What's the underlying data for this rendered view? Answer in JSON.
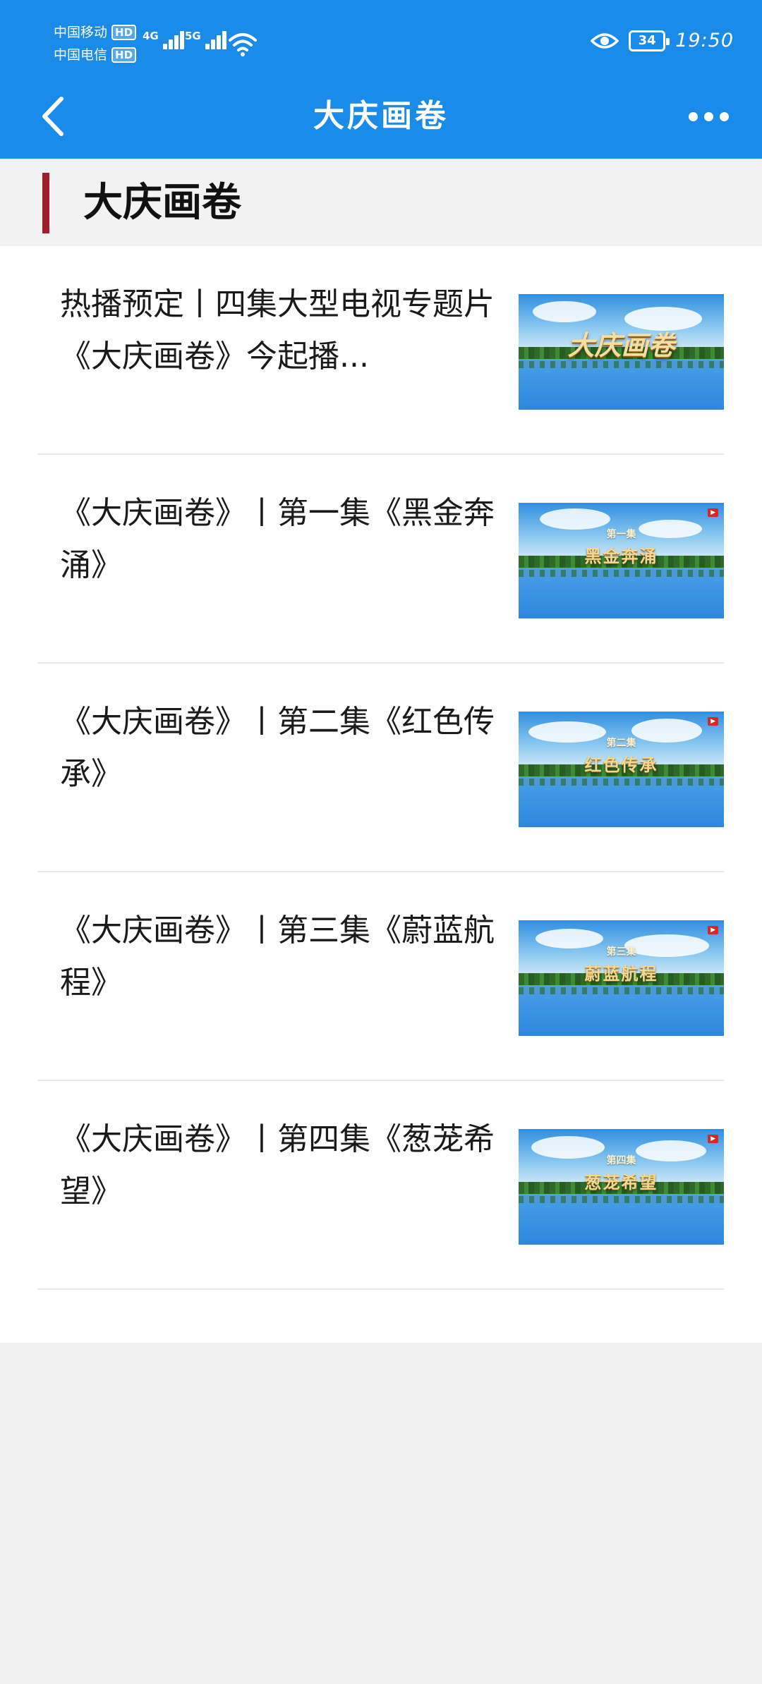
{
  "status_bar": {
    "carrier_1": "中国移动",
    "carrier_2": "中国电信",
    "hd_badge": "HD",
    "net_1": "4G",
    "net_2": "5G",
    "battery_level": "34",
    "time": "19:50"
  },
  "app_bar": {
    "title": "大庆画卷",
    "back_icon": "chevron-left-icon",
    "more_icon": "more-dots-icon"
  },
  "section": {
    "title": "大庆画卷",
    "accent_color": "#a01d2c"
  },
  "colors": {
    "header_bg": "#1a8be8",
    "page_bg": "#f0f0f0"
  },
  "articles": [
    {
      "title": "热播预定丨四集大型电视专题片《大庆画卷》今起播...",
      "thumb_title": "大庆画卷"
    },
    {
      "title": "《大庆画卷》丨第一集《黑金奔涌》",
      "thumb_episode": "第一集",
      "thumb_name": "黑金奔涌"
    },
    {
      "title": "《大庆画卷》丨第二集《红色传承》",
      "thumb_episode": "第二集",
      "thumb_name": "红色传承"
    },
    {
      "title": "《大庆画卷》丨第三集《蔚蓝航程》",
      "thumb_episode": "第三集",
      "thumb_name": "蔚蓝航程"
    },
    {
      "title": "《大庆画卷》丨第四集《葱茏希望》",
      "thumb_episode": "第四集",
      "thumb_name": "葱茏希望"
    }
  ]
}
